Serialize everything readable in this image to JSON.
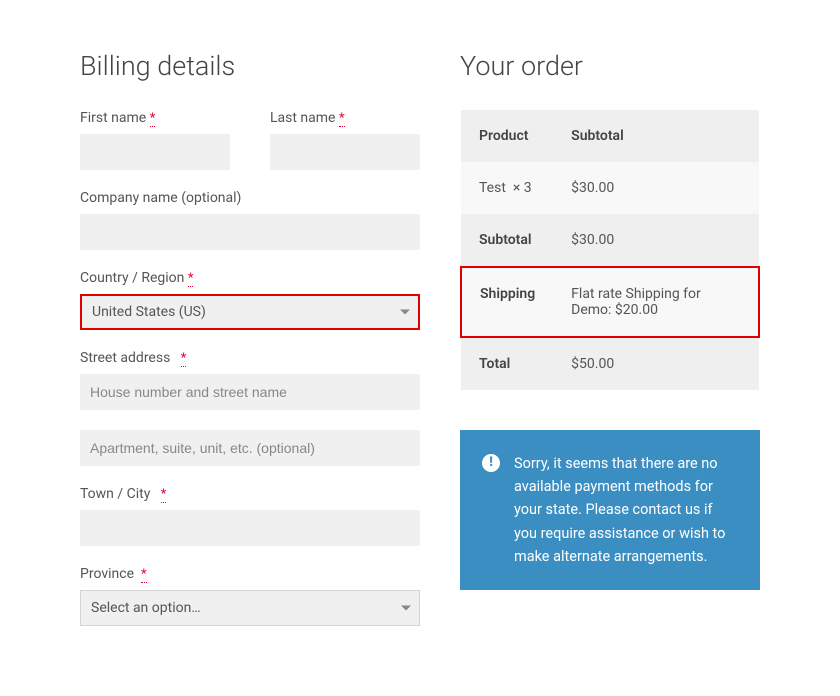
{
  "billing": {
    "title": "Billing details",
    "first_name_label": "First name",
    "last_name_label": "Last name",
    "company_label": "Company name (optional)",
    "country_label": "Country / Region",
    "country_value": "United States (US)",
    "street_label": "Street address",
    "street_placeholder": "House number and street name",
    "street2_placeholder": "Apartment, suite, unit, etc. (optional)",
    "city_label": "Town / City",
    "province_label": "Province",
    "province_placeholder": "Select an option…",
    "required_marker": "*"
  },
  "order": {
    "title": "Your order",
    "header_product": "Product",
    "header_subtotal": "Subtotal",
    "line_item_name": "Test",
    "line_item_qty": "× 3",
    "line_item_total": "$30.00",
    "subtotal_label": "Subtotal",
    "subtotal_value": "$30.00",
    "shipping_label": "Shipping",
    "shipping_value": "Flat rate Shipping for Demo: $20.00",
    "total_label": "Total",
    "total_value": "$50.00"
  },
  "notice": {
    "text": "Sorry, it seems that there are no available payment methods for your state. Please contact us if you require assistance or wish to make alternate arrangements."
  }
}
